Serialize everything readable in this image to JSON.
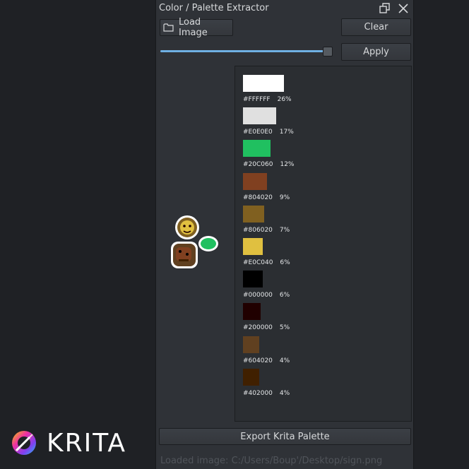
{
  "window": {
    "title": "Color / Palette Extractor"
  },
  "toolbar": {
    "load_label": "Load Image",
    "clear_label": "Clear",
    "apply_label": "Apply"
  },
  "slider": {
    "value_fraction": 0.97
  },
  "palette": [
    {
      "hex": "#FFFFFF",
      "pct": "26%",
      "color": "#ffffff",
      "share": 26
    },
    {
      "hex": "#E0E0E0",
      "pct": "17%",
      "color": "#e0e0e0",
      "share": 17
    },
    {
      "hex": "#20C060",
      "pct": "12%",
      "color": "#20c060",
      "share": 12
    },
    {
      "hex": "#804020",
      "pct": "9%",
      "color": "#804020",
      "share": 9
    },
    {
      "hex": "#806020",
      "pct": "7%",
      "color": "#806020",
      "share": 7
    },
    {
      "hex": "#E0C040",
      "pct": "6%",
      "color": "#e0c040",
      "share": 6
    },
    {
      "hex": "#000000",
      "pct": "6%",
      "color": "#000000",
      "share": 6
    },
    {
      "hex": "#200000",
      "pct": "5%",
      "color": "#200000",
      "share": 5
    },
    {
      "hex": "#604020",
      "pct": "4%",
      "color": "#604020",
      "share": 4
    },
    {
      "hex": "#402000",
      "pct": "4%",
      "color": "#402000",
      "share": 4
    }
  ],
  "footer": {
    "export_label": "Export Krita Palette",
    "status": "Loaded image: C:/Users/Boup'/Desktop/sign.png"
  },
  "branding": {
    "wordmark": "KRITA"
  },
  "icons": {
    "load": "folder-icon",
    "float": "float-window-icon",
    "close": "close-icon",
    "logo": "krita-logo-icon"
  }
}
